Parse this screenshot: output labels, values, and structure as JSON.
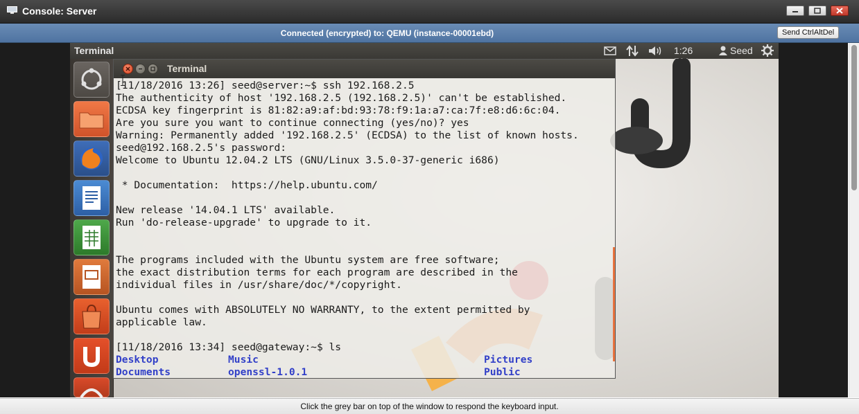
{
  "window": {
    "title": "Console: Server",
    "colors": {
      "titlebar": "#2b2b2b",
      "conn_bar": "#5a7dab",
      "close": "#c0392b"
    }
  },
  "connection": {
    "status": "Connected (encrypted) to: QEMU (instance-00001ebd)",
    "ctrl_alt_del_label": "Send CtrlAltDel"
  },
  "ubuntu_panel": {
    "app_name": "Terminal",
    "indicators": [
      "mail-icon",
      "network-arrows-icon",
      "volume-icon"
    ],
    "clock": "1:26 PM",
    "user": "Seed",
    "session_icon": "gear-icon"
  },
  "launcher": {
    "items": [
      {
        "name": "dash-home",
        "icon": "ubuntu-logo-icon"
      },
      {
        "name": "files",
        "icon": "folder-icon"
      },
      {
        "name": "firefox",
        "icon": "firefox-icon"
      },
      {
        "name": "writer",
        "icon": "libreoffice-writer-icon"
      },
      {
        "name": "calc",
        "icon": "libreoffice-calc-icon"
      },
      {
        "name": "impress",
        "icon": "libreoffice-impress-icon"
      },
      {
        "name": "software-center",
        "icon": "shopping-bag-icon"
      },
      {
        "name": "ubuntu-one",
        "icon": "ubuntu-one-icon"
      },
      {
        "name": "system-settings",
        "icon": "settings-icon"
      }
    ]
  },
  "terminal": {
    "title": "Terminal",
    "lines": [
      "[11/18/2016 13:26] seed@server:~$ ssh 192.168.2.5",
      "The authenticity of host '192.168.2.5 (192.168.2.5)' can't be established.",
      "ECDSA key fingerprint is 81:82:a9:af:bd:93:78:f9:1a:a7:ca:7f:e8:d6:6c:04.",
      "Are you sure you want to continue connecting (yes/no)? yes",
      "Warning: Permanently added '192.168.2.5' (ECDSA) to the list of known hosts.",
      "seed@192.168.2.5's password:",
      "Welcome to Ubuntu 12.04.2 LTS (GNU/Linux 3.5.0-37-generic i686)",
      "",
      " * Documentation:  https://help.ubuntu.com/",
      "",
      "New release '14.04.1 LTS' available.",
      "Run 'do-release-upgrade' to upgrade to it.",
      "",
      "",
      "The programs included with the Ubuntu system are free software;",
      "the exact distribution terms for each program are described in the",
      "individual files in /usr/share/doc/*/copyright.",
      "",
      "Ubuntu comes with ABSOLUTELY NO WARRANTY, to the extent permitted by",
      "applicable law.",
      "",
      "[11/18/2016 13:34] seed@gateway:~$ ls"
    ],
    "ls_output": {
      "row1": [
        "Desktop",
        "Music",
        "Pictures"
      ],
      "row2": [
        "Documents",
        "openssl-1.0.1",
        "Public"
      ]
    },
    "ls_color": "#3240c8",
    "scrollbar_color": "#e8733f"
  },
  "status_bar": {
    "text": "Click the grey bar on top of the window to respond the keyboard input."
  }
}
